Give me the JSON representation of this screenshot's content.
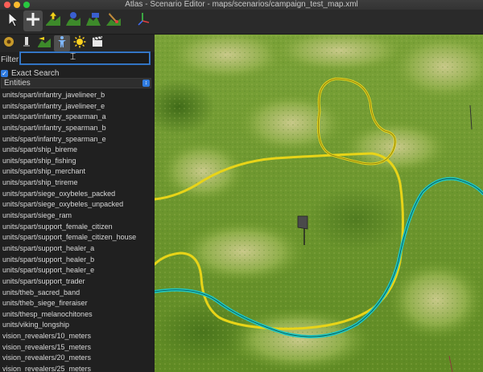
{
  "window": {
    "title": "Atlas - Scenario Editor - maps/scenarios/campaign_test_map.xml"
  },
  "toolbar": {
    "tools": [
      {
        "icon": "select-arrow-icon",
        "active": false
      },
      {
        "icon": "move-cross-icon",
        "active": true
      },
      {
        "icon": "raise-terrain-icon",
        "active": false
      },
      {
        "icon": "smooth-terrain-icon",
        "active": false
      },
      {
        "icon": "flatten-terrain-icon",
        "active": false
      },
      {
        "icon": "paint-terrain-icon",
        "active": false
      },
      {
        "icon": "axes-gizmo-icon",
        "active": false
      }
    ]
  },
  "panel": {
    "tabs": [
      {
        "icon": "map-settings-icon",
        "active": false
      },
      {
        "icon": "player-icon",
        "active": false
      },
      {
        "icon": "terrain-icon",
        "active": false
      },
      {
        "icon": "object-unit-icon",
        "active": true
      },
      {
        "icon": "environment-sun-icon",
        "active": false
      },
      {
        "icon": "cinematic-clapper-icon",
        "active": false
      }
    ],
    "filter_label": "Filter",
    "filter_value": "",
    "exact_search_label": "Exact Search",
    "exact_search_checked": true,
    "category_select": "Entities",
    "entities": [
      "units/spart/infantry_javelineer_b",
      "units/spart/infantry_javelineer_e",
      "units/spart/infantry_spearman_a",
      "units/spart/infantry_spearman_b",
      "units/spart/infantry_spearman_e",
      "units/spart/ship_bireme",
      "units/spart/ship_fishing",
      "units/spart/ship_merchant",
      "units/spart/ship_trireme",
      "units/spart/siege_oxybeles_packed",
      "units/spart/siege_oxybeles_unpacked",
      "units/spart/siege_ram",
      "units/spart/support_female_citizen",
      "units/spart/support_female_citizen_house",
      "units/spart/support_healer_a",
      "units/spart/support_healer_b",
      "units/spart/support_healer_e",
      "units/spart/support_trader",
      "units/theb_sacred_band",
      "units/theb_siege_fireraiser",
      "units/thesp_melanochitones",
      "units/viking_longship",
      "vision_revealers/10_meters",
      "vision_revealers/15_meters",
      "vision_revealers/20_meters",
      "vision_revealers/25_meters"
    ]
  },
  "colors": {
    "accent": "#2f7be0",
    "territory_yellow": "#e8d418",
    "territory_cyan": "#1fc6c0",
    "grass": "#6f9a2c"
  }
}
